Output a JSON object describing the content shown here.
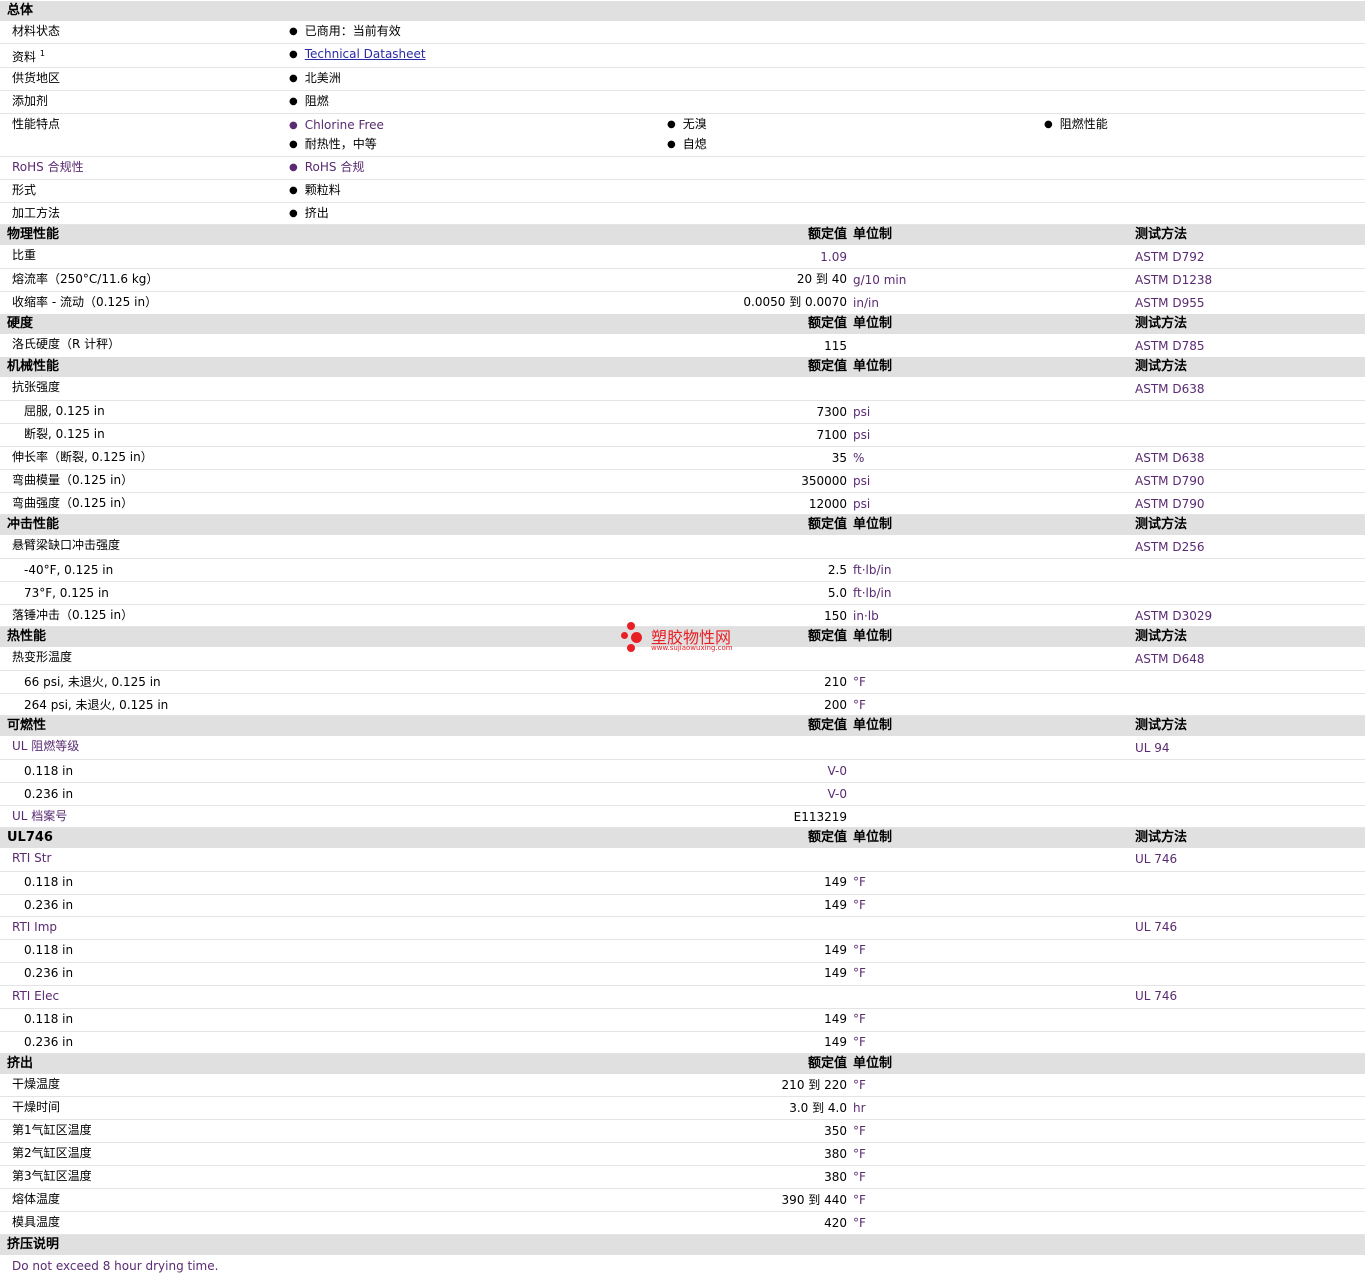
{
  "general": {
    "title": "总体",
    "status_label": "材料状态",
    "status_value": "已商用：当前有效",
    "doc_label": "资料",
    "doc_sup": "1",
    "doc_value": "Technical Datasheet",
    "region_label": "供货地区",
    "region_value": "北美洲",
    "additive_label": "添加剂",
    "additive_value": "阻燃",
    "features_label": "性能特点",
    "features": [
      "Chlorine Free",
      "无溴",
      "阻燃性能",
      "耐热性，中等",
      "自熄"
    ],
    "rohs_label": "RoHS 合规性",
    "rohs_value": "RoHS 合规",
    "form_label": "形式",
    "form_value": "颗粒料",
    "process_label": "加工方法",
    "process_value": "挤出"
  },
  "col_headers": {
    "value": "额定值",
    "unit": "单位制",
    "method": "测试方法"
  },
  "sections": {
    "physical": "物理性能",
    "hardness": "硬度",
    "mechanical": "机械性能",
    "impact": "冲击性能",
    "thermal": "热性能",
    "flammability": "可燃性",
    "ul746": "UL746",
    "extrusion": "挤出",
    "extrusion_notes": "挤压说明"
  },
  "rows": {
    "sg": {
      "label": "比重",
      "value": "1.09",
      "unit": "",
      "method": "ASTM D792"
    },
    "mfr": {
      "label": "熔流率（250°C/11.6 kg）",
      "value": "20 到  40",
      "unit": "g/10 min",
      "method": "ASTM D1238"
    },
    "shrink": {
      "label": "收缩率 - 流动（0.125 in）",
      "value": "0.0050 到  0.0070",
      "unit": "in/in",
      "method": "ASTM D955"
    },
    "rockwell": {
      "label": "洛氏硬度（R 计秤）",
      "value": "115",
      "unit": "",
      "method": "ASTM D785"
    },
    "tensile": {
      "label": "抗张强度",
      "method": "ASTM D638"
    },
    "tensile_yield": {
      "label": "屈服, 0.125 in",
      "value": "7300",
      "unit": "psi"
    },
    "tensile_break": {
      "label": "断裂, 0.125 in",
      "value": "7100",
      "unit": "psi"
    },
    "elong": {
      "label": "伸长率（断裂, 0.125 in）",
      "value": "35",
      "unit": "%",
      "method": "ASTM D638"
    },
    "flex_mod": {
      "label": "弯曲模量（0.125 in）",
      "value": "350000",
      "unit": "psi",
      "method": "ASTM D790"
    },
    "flex_str": {
      "label": "弯曲强度（0.125 in）",
      "value": "12000",
      "unit": "psi",
      "method": "ASTM D790"
    },
    "izod": {
      "label": "悬臂梁缺口冲击强度",
      "method": "ASTM D256"
    },
    "izod_m40": {
      "label": "-40°F, 0.125 in",
      "value": "2.5",
      "unit": "ft·lb/in"
    },
    "izod_73": {
      "label": "73°F, 0.125 in",
      "value": "5.0",
      "unit": "ft·lb/in"
    },
    "dart": {
      "label": "落锤冲击（0.125 in）",
      "value": "150",
      "unit": "in·lb",
      "method": "ASTM D3029"
    },
    "hdt": {
      "label": "热变形温度",
      "method": "ASTM D648"
    },
    "hdt_66": {
      "label": "66 psi, 未退火, 0.125 in",
      "value": "210",
      "unit": "°F"
    },
    "hdt_264": {
      "label": "264 psi, 未退火, 0.125 in",
      "value": "200",
      "unit": "°F"
    },
    "ul_rating": {
      "label": "UL 阻燃等级",
      "method": "UL 94"
    },
    "ul_118": {
      "label": "0.118 in",
      "value": "V-0"
    },
    "ul_236": {
      "label": "0.236 in",
      "value": "V-0"
    },
    "ul_file": {
      "label": "UL 档案号",
      "value": "E113219"
    },
    "rti_str": {
      "label": "RTI Str",
      "method": "UL 746"
    },
    "rti_str_118": {
      "label": "0.118 in",
      "value": "149",
      "unit": "°F"
    },
    "rti_str_236": {
      "label": "0.236 in",
      "value": "149",
      "unit": "°F"
    },
    "rti_imp": {
      "label": "RTI Imp",
      "method": "UL 746"
    },
    "rti_imp_118": {
      "label": "0.118 in",
      "value": "149",
      "unit": "°F"
    },
    "rti_imp_236": {
      "label": "0.236 in",
      "value": "149",
      "unit": "°F"
    },
    "rti_elec": {
      "label": "RTI Elec",
      "method": "UL 746"
    },
    "rti_elec_118": {
      "label": "0.118 in",
      "value": "149",
      "unit": "°F"
    },
    "rti_elec_236": {
      "label": "0.236 in",
      "value": "149",
      "unit": "°F"
    },
    "dry_temp": {
      "label": "干燥温度",
      "value": "210 到  220",
      "unit": "°F"
    },
    "dry_time": {
      "label": "干燥时间",
      "value": "3.0 到  4.0",
      "unit": "hr"
    },
    "zone1": {
      "label": "第1气缸区温度",
      "value": "350",
      "unit": "°F"
    },
    "zone2": {
      "label": "第2气缸区温度",
      "value": "380",
      "unit": "°F"
    },
    "zone3": {
      "label": "第3气缸区温度",
      "value": "380",
      "unit": "°F"
    },
    "melt": {
      "label": "熔体温度",
      "value": "390 到  440",
      "unit": "°F"
    },
    "die": {
      "label": "模具温度",
      "value": "420",
      "unit": "°F"
    }
  },
  "notes": "Do not exceed 8 hour drying time.",
  "watermark": {
    "title": "塑胶物性网",
    "url": "www.sujiaowuxing.com"
  }
}
